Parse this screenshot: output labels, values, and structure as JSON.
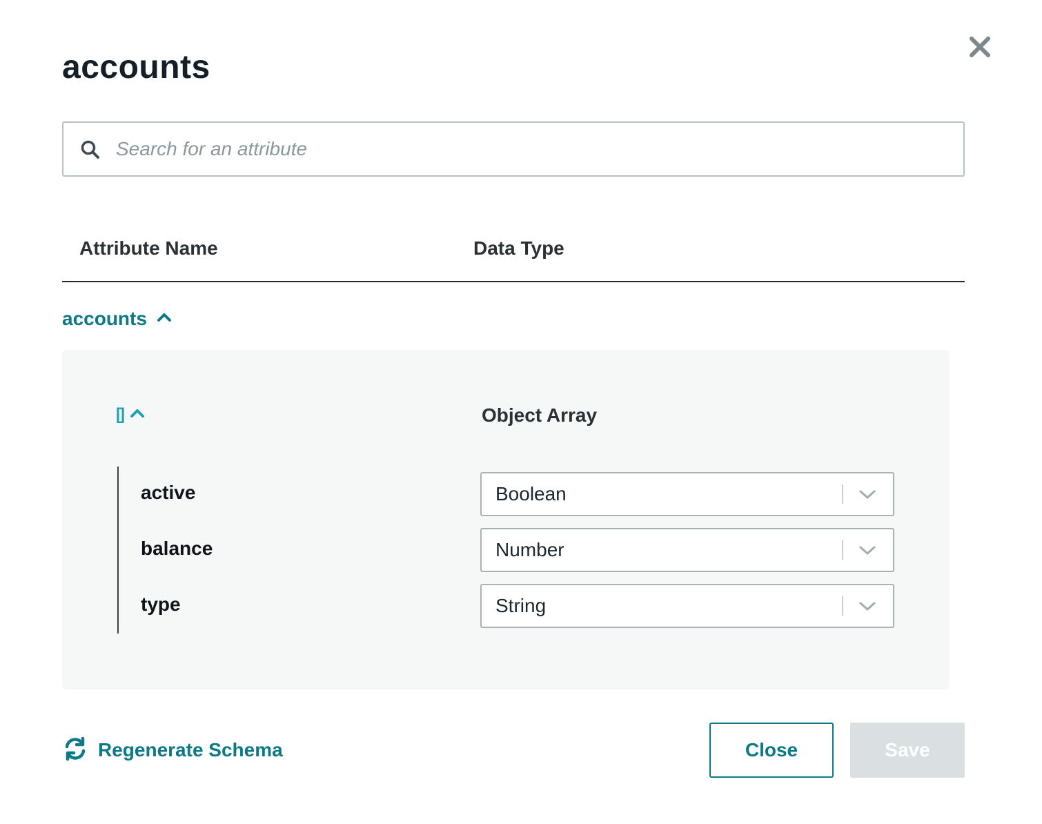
{
  "dialog": {
    "title": "accounts",
    "close_icon": "close-icon"
  },
  "search": {
    "placeholder": "Search for an attribute",
    "value": "",
    "icon": "search-icon"
  },
  "table": {
    "headers": [
      "Attribute Name",
      "Data Type"
    ]
  },
  "group": {
    "label": "accounts",
    "expanded": true,
    "icon": "chevron-up-icon",
    "array": {
      "symbol": "[]",
      "expanded": true,
      "data_type": "Object Array",
      "attributes": [
        {
          "name": "active",
          "type": "Boolean"
        },
        {
          "name": "balance",
          "type": "Number"
        },
        {
          "name": "type",
          "type": "String"
        }
      ]
    }
  },
  "footer": {
    "regenerate_label": "Regenerate Schema",
    "regenerate_icon": "refresh-icon",
    "close_label": "Close",
    "save_label": "Save",
    "save_enabled": false
  },
  "colors": {
    "accent": "#0c7a86",
    "array_accent": "#1aa3b5",
    "panel_bg": "#f6f8f7",
    "disabled_button": "#dadfe1"
  }
}
